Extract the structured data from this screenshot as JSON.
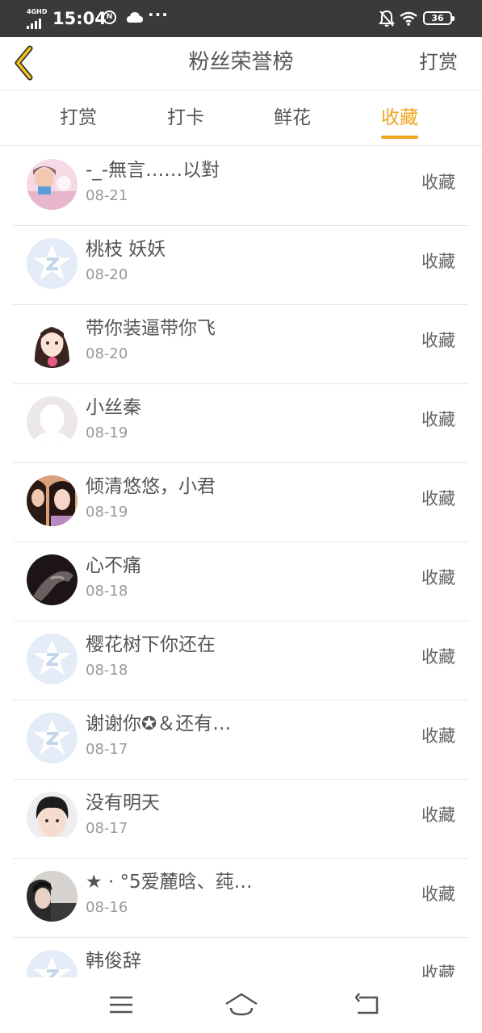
{
  "status": {
    "network": "4GHD",
    "time": "15:04",
    "circle_icon_text": "N",
    "more": "···",
    "battery": "36"
  },
  "header": {
    "title": "粉丝荣誉榜",
    "action": "打赏"
  },
  "tabs": [
    {
      "label": "打赏",
      "active": false
    },
    {
      "label": "打卡",
      "active": false
    },
    {
      "label": "鲜花",
      "active": false
    },
    {
      "label": "收藏",
      "active": true
    }
  ],
  "rows": [
    {
      "name": "-_-無言……以對",
      "date": "08-21",
      "action": "收藏",
      "avatar": "photo-girl-pink"
    },
    {
      "name": "桃枝 妖妖",
      "date": "08-20",
      "action": "收藏",
      "avatar": "default-qzone-icon"
    },
    {
      "name": "带你装逼带你飞",
      "date": "08-20",
      "action": "收藏",
      "avatar": "cartoon-girl"
    },
    {
      "name": "小丝秦",
      "date": "08-19",
      "action": "收藏",
      "avatar": "default-silhouette"
    },
    {
      "name": "倾清悠悠，小君",
      "date": "08-19",
      "action": "收藏",
      "avatar": "photo-two-girls"
    },
    {
      "name": "心不痛",
      "date": "08-18",
      "action": "收藏",
      "avatar": "photo-hand-dark"
    },
    {
      "name": "樱花树下你还在",
      "date": "08-18",
      "action": "收藏",
      "avatar": "default-qzone-icon"
    },
    {
      "name": "谢谢你✪＆还有…",
      "date": "08-17",
      "action": "收藏",
      "avatar": "default-qzone-icon"
    },
    {
      "name": "没有明天",
      "date": "08-17",
      "action": "收藏",
      "avatar": "photo-boy"
    },
    {
      "name": "★ · °5爱麓晗、莼…",
      "date": "08-16",
      "action": "收藏",
      "avatar": "photo-boy-dark"
    },
    {
      "name": "韩俊辞",
      "date": "",
      "action": "收藏",
      "avatar": "default-qzone-icon"
    }
  ],
  "colors": {
    "accent": "#f0a41c",
    "status_bar": "#3a3a3a",
    "text": "#555555",
    "muted": "#999999"
  }
}
